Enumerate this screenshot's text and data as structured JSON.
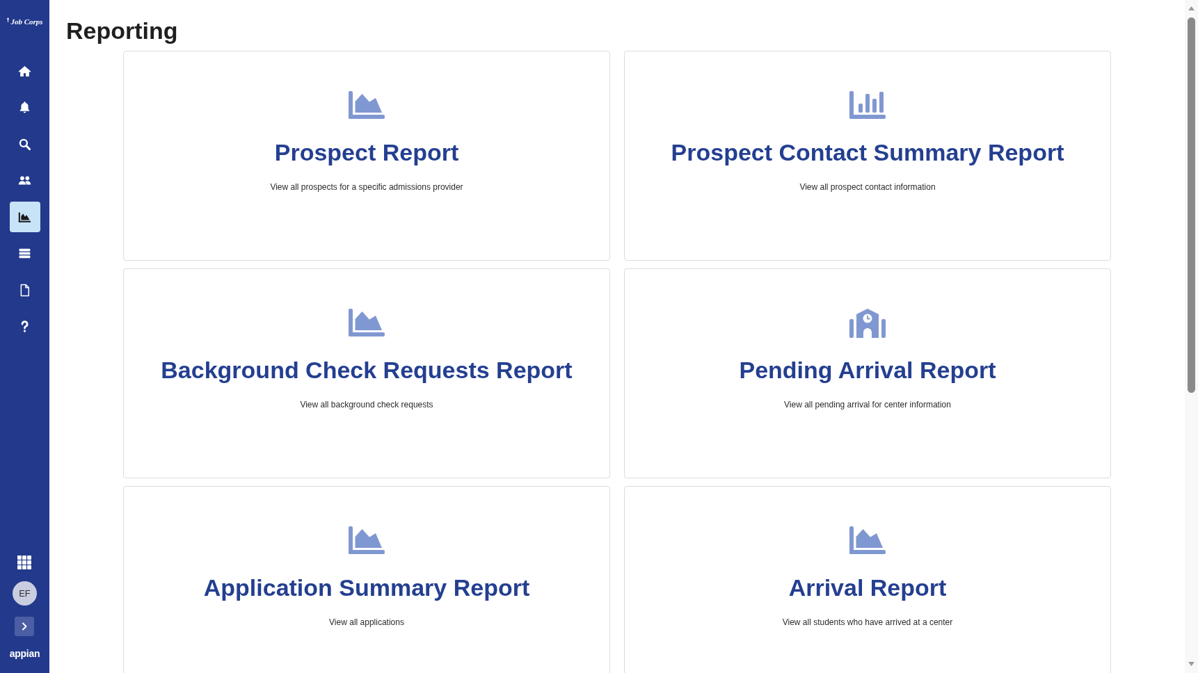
{
  "sidebar": {
    "logo": "Job Corps",
    "nav_items": [
      {
        "kind": "home",
        "selected": false
      },
      {
        "kind": "bell",
        "selected": false
      },
      {
        "kind": "search",
        "selected": false
      },
      {
        "kind": "people",
        "selected": false
      },
      {
        "kind": "chart",
        "selected": true
      },
      {
        "kind": "records",
        "selected": false
      },
      {
        "kind": "document",
        "selected": false
      },
      {
        "kind": "help",
        "selected": false
      }
    ],
    "avatar": "EF",
    "brand": "appian"
  },
  "page_title": "Reporting",
  "reports": [
    {
      "kind": "area",
      "title": "Prospect Report",
      "description": "View all prospects for a specific admissions provider"
    },
    {
      "kind": "bars",
      "title": "Prospect Contact Summary Report",
      "description": "View all prospect contact information"
    },
    {
      "kind": "area",
      "title": "Background Check Requests Report",
      "description": "View all background check requests"
    },
    {
      "kind": "building",
      "title": "Pending Arrival Report",
      "description": "View all pending arrival for center information"
    },
    {
      "kind": "area",
      "title": "Application Summary Report",
      "description": "View all applications"
    },
    {
      "kind": "area",
      "title": "Arrival Report",
      "description": "View all students who have arrived at a center"
    }
  ]
}
